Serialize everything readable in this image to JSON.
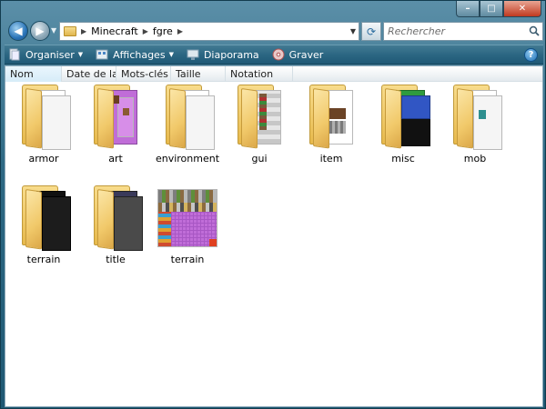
{
  "window": {
    "controls": {
      "minimize": "–",
      "maximize": "□",
      "close": "✕"
    }
  },
  "navigation": {
    "back_icon": "arrow-left-icon",
    "forward_icon": "arrow-right-icon",
    "breadcrumb": [
      "Minecraft",
      "fgre"
    ],
    "search_placeholder": "Rechercher"
  },
  "toolbar": {
    "organiser": "Organiser",
    "affichages": "Affichages",
    "diaporama": "Diaporama",
    "graver": "Graver",
    "help": "?"
  },
  "columns": [
    "Nom",
    "Date de la ...",
    "Mots-clés",
    "Taille",
    "Notation"
  ],
  "items": [
    {
      "name": "armor",
      "type": "folder",
      "preview": "white"
    },
    {
      "name": "art",
      "type": "folder",
      "preview": "art"
    },
    {
      "name": "environment",
      "type": "folder",
      "preview": "white"
    },
    {
      "name": "gui",
      "type": "folder",
      "preview": "gui"
    },
    {
      "name": "item",
      "type": "folder",
      "preview": "item"
    },
    {
      "name": "misc",
      "type": "folder",
      "preview": "misc"
    },
    {
      "name": "mob",
      "type": "folder",
      "preview": "mob"
    },
    {
      "name": "terrain",
      "type": "folder",
      "preview": "dark"
    },
    {
      "name": "title",
      "type": "folder",
      "preview": "title"
    },
    {
      "name": "terrain",
      "type": "image",
      "preview": "terrain-png"
    }
  ],
  "colors": {
    "frame": "#2e6984",
    "toolbar": "#2c6783",
    "folder": "#f1c96a",
    "accent_purple": "#c06dd8"
  }
}
